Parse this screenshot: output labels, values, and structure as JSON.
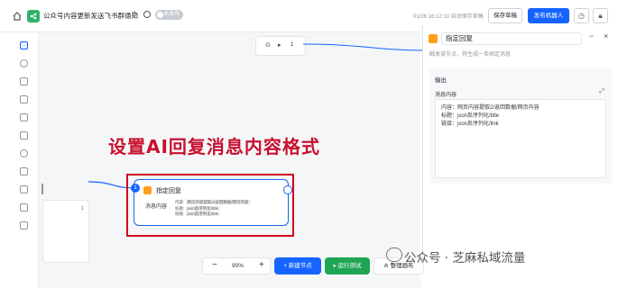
{
  "header": {
    "app_title": "公众号内容更新发送飞书群通知",
    "status_label": "未发布",
    "autosave_text": "01/06 16:12:10 自动保存草稿",
    "save_label": "保存草稿",
    "publish_label": "发布机器人"
  },
  "canvas": {
    "left_node_number": "1",
    "top_node_number": "1",
    "headline": "设置AI回复消息内容格式",
    "node": {
      "badge": "1",
      "title": "指定回复",
      "label": "消息内容",
      "lines": [
        {
          "key": "内容:",
          "value": "网页内容提取2/返回数据/网页内容"
        },
        {
          "key": "标题:",
          "value": "json反序列化/title"
        },
        {
          "key": "链接:",
          "value": "json反序列化/link"
        }
      ]
    },
    "toolbar": {
      "zoom": "90%",
      "add_node_label": "新建节点",
      "run_label": "运行测试",
      "arrange_label": "整理画布"
    }
  },
  "panel": {
    "title": "指定回复",
    "description": "触发该节点，将生成一条固定消息",
    "output_label": "输出",
    "message_label": "消息内容",
    "content_lines": [
      "内容：网页内容提取2/返回数据/网页内容",
      "标题：json反序列化/title",
      "链接：json反序列化/link"
    ]
  },
  "watermark": "公众号 · 芝麻私域流量",
  "colors": {
    "primary": "#1664ff",
    "run_green": "#1fa553",
    "highlight_red": "#c8102e",
    "node_orange": "#ff9f1a"
  }
}
